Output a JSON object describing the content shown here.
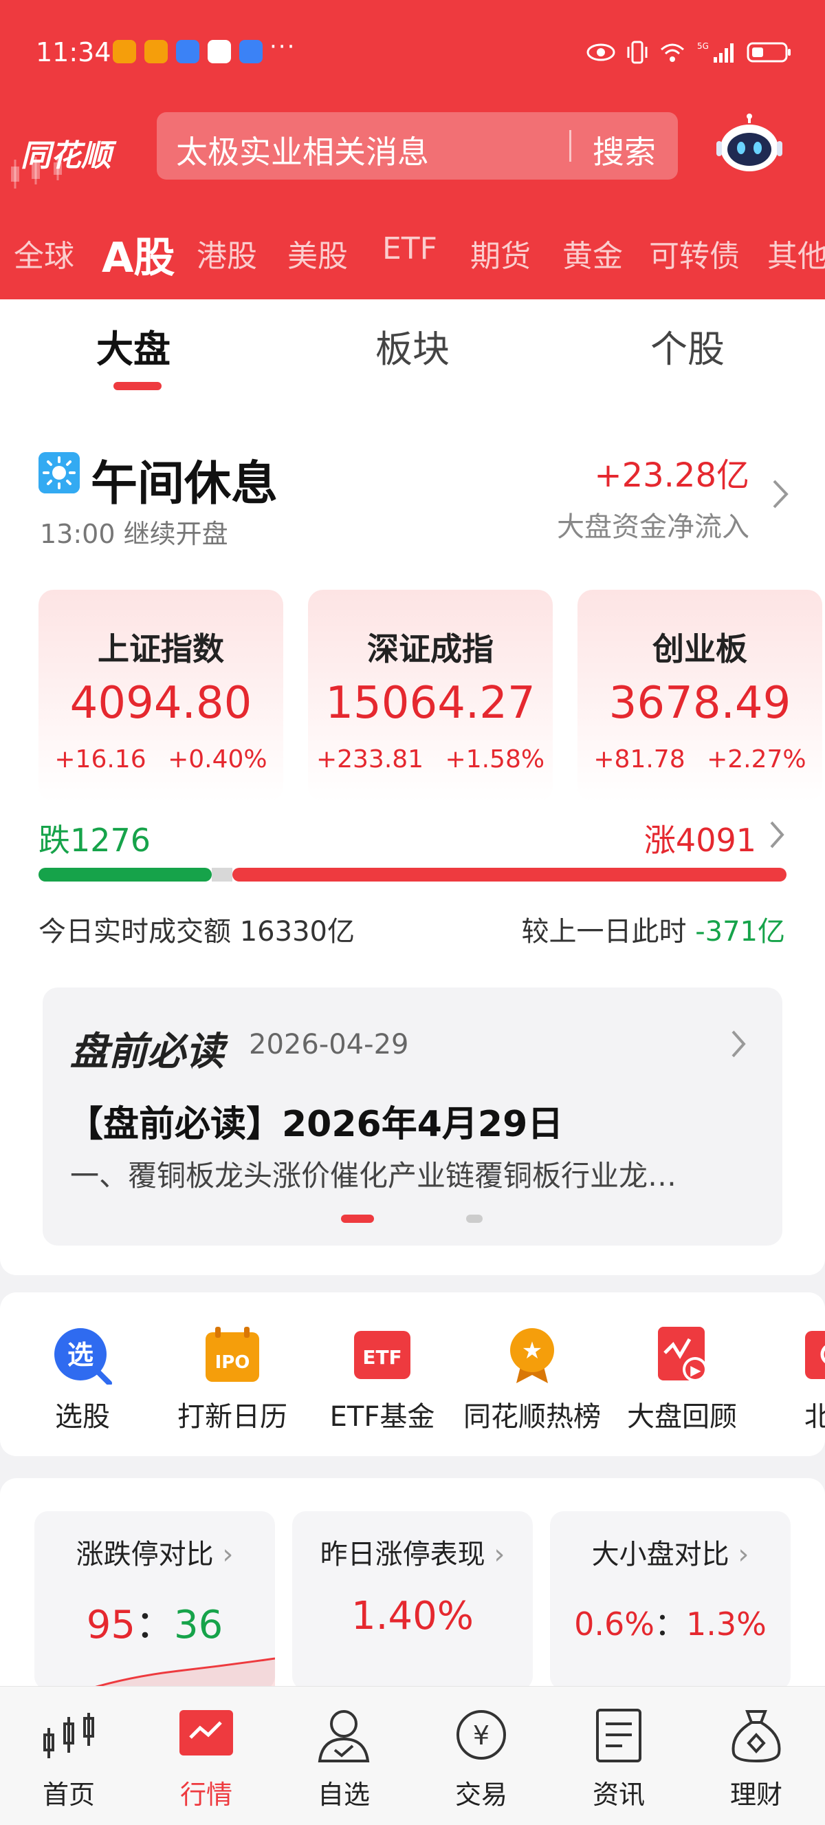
{
  "status_bar": {
    "time": "11:34",
    "dots": "···",
    "network": "5G"
  },
  "header": {
    "brand": "同花顺",
    "search_placeholder": "太极实业相关消息",
    "search_button": "搜索"
  },
  "market_tabs": [
    {
      "label": "全球"
    },
    {
      "label": "A股"
    },
    {
      "label": "港股"
    },
    {
      "label": "美股"
    },
    {
      "label": "ETF"
    },
    {
      "label": "期货"
    },
    {
      "label": "黄金"
    },
    {
      "label": "可转债"
    },
    {
      "label": "其他"
    }
  ],
  "sub_tabs": [
    {
      "label": "大盘"
    },
    {
      "label": "板块"
    },
    {
      "label": "个股"
    }
  ],
  "session": {
    "title": "午间休息",
    "subtitle": "13:00 继续开盘",
    "net_flow_value": "+23.28亿",
    "net_flow_label": "大盘资金净流入"
  },
  "indices": [
    {
      "name": "上证指数",
      "value": "4094.80",
      "change": "+16.16",
      "pct": "+0.40%"
    },
    {
      "name": "深证成指",
      "value": "15064.27",
      "change": "+233.81",
      "pct": "+1.58%"
    },
    {
      "name": "创业板",
      "value": "3678.49",
      "change": "+81.78",
      "pct": "+2.27%"
    }
  ],
  "breadth": {
    "fall": "跌1276",
    "rise": "涨4091",
    "fall_count": 1276,
    "rise_count": 4091
  },
  "turnover": {
    "label": "今日实时成交额",
    "value": "16330亿",
    "compare_label": "较上一日此时",
    "compare_value": "-371亿"
  },
  "news": {
    "logo": "盘前必读",
    "date": "2026-04-29",
    "title": "【盘前必读】2026年4月29日",
    "body": "一、覆铜板龙头涨价催化产业链覆铜板行业龙…"
  },
  "shortcuts": [
    {
      "label": "选股",
      "icon": "search-stock-icon",
      "glyph": "选"
    },
    {
      "label": "打新日历",
      "icon": "ipo-calendar-icon",
      "glyph": "IPO"
    },
    {
      "label": "ETF基金",
      "icon": "etf-icon",
      "glyph": "ETF"
    },
    {
      "label": "同花顺热榜",
      "icon": "hot-list-icon",
      "glyph": "★"
    },
    {
      "label": "大盘回顾",
      "icon": "market-review-icon",
      "glyph": "▶"
    },
    {
      "label": "北京",
      "icon": "beijing-icon",
      "glyph": ""
    }
  ],
  "stats": [
    {
      "title": "涨跌停对比",
      "value_up": "95",
      "sep": "：",
      "value_down": "36"
    },
    {
      "title": "昨日涨停表现",
      "value": "1.40%"
    },
    {
      "title": "大小盘对比",
      "value_a": "0.6%",
      "sep": "：",
      "value_b": "1.3%"
    }
  ],
  "bottom_nav": [
    {
      "label": "首页",
      "icon": "home-candlestick-icon"
    },
    {
      "label": "行情",
      "icon": "market-chart-icon"
    },
    {
      "label": "自选",
      "icon": "watchlist-person-icon"
    },
    {
      "label": "交易",
      "icon": "yuan-trade-icon"
    },
    {
      "label": "资讯",
      "icon": "news-document-icon"
    },
    {
      "label": "理财",
      "icon": "wealth-bag-icon"
    }
  ],
  "colors": {
    "brand_red": "#ee3a3f",
    "up_red": "#e5282f",
    "down_green": "#16a34a"
  }
}
